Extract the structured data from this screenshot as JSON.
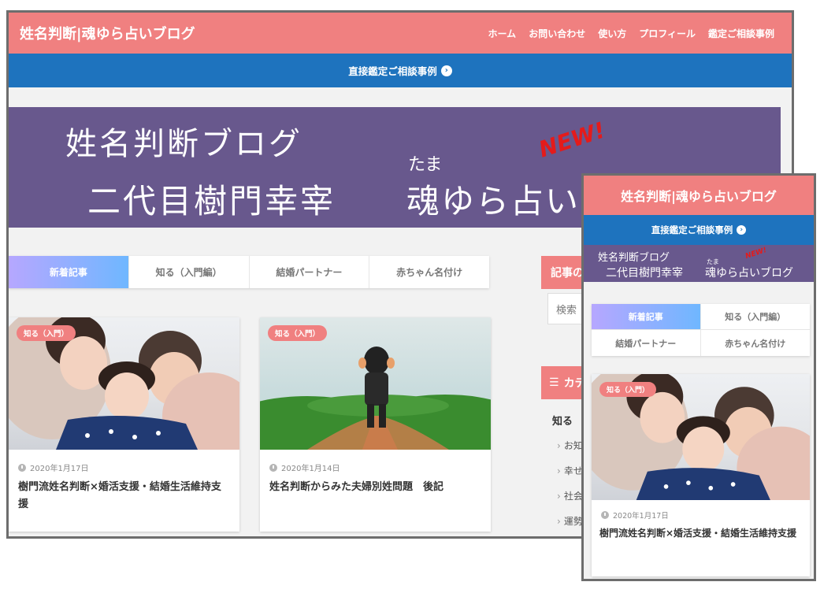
{
  "desktop": {
    "site_title": "姓名判断|魂ゆら占いブログ",
    "nav": [
      "ホーム",
      "お問い合わせ",
      "使い方",
      "プロフィール",
      "鑑定ご相談事例"
    ],
    "cta": "直接鑑定ご相談事例",
    "banner": {
      "line1": "姓名判断ブログ",
      "line2": "二代目樹門幸宰",
      "line3": "魂ゆら占いブログ",
      "ruby": "たま",
      "new": "NEW!"
    },
    "tabs": [
      "新着記事",
      "知る（入門編）",
      "結婚パートナー",
      "赤ちゃん名付け"
    ],
    "articles": [
      {
        "badge": "知る（入門）",
        "date": "2020年1月17日",
        "title": "樹門流姓名判断×婚活支援・結婚生活維持支援"
      },
      {
        "badge": "知る（入門）",
        "date": "2020年1月14日",
        "title": "姓名判断からみた夫婦別姓問題　後記"
      }
    ],
    "sidebar": {
      "box1": "記事の",
      "search_placeholder": "検索",
      "box2": "カテ",
      "cat_head": "知る",
      "cats": [
        "お知",
        "幸せ",
        "社会",
        "運勢"
      ]
    }
  },
  "mobile": {
    "site_title": "姓名判断|魂ゆら占いブログ",
    "cta": "直接鑑定ご相談事例",
    "banner": {
      "line1": "姓名判断ブログ",
      "line2": "二代目樹門幸宰",
      "line3": "魂ゆら占いブログ",
      "ruby": "たま",
      "new": "NEW!"
    },
    "tabs": [
      "新着記事",
      "知る（入門編）",
      "結婚パートナー",
      "赤ちゃん名付け"
    ],
    "article": {
      "badge": "知る（入門）",
      "date": "2020年1月17日",
      "title": "樹門流姓名判断×婚活支援・結婚生活維持支援"
    }
  },
  "colors": {
    "header": "#f08080",
    "cta": "#1e73be",
    "banner": "#68588d",
    "new": "#e41b1b"
  }
}
